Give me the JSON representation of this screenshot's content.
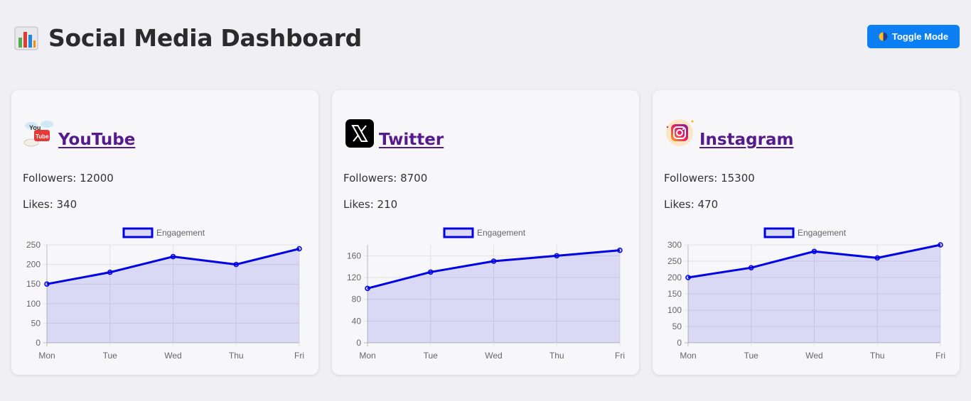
{
  "header": {
    "title": "Social Media Dashboard",
    "title_icon": "bar-chart-icon",
    "toggle_label": "Toggle Mode",
    "toggle_icon": "half-circle-icon"
  },
  "colors": {
    "accent": "#0d7ff5",
    "line": "#0000e6",
    "fill": "rgba(0,0,230,0.12)",
    "link": "#551a8b"
  },
  "cards": [
    {
      "platform": "YouTube",
      "logo_icon": "youtube-logo-icon",
      "followers_text": "Followers: 12000",
      "likes_text": "Likes: 340"
    },
    {
      "platform": "Twitter",
      "logo_icon": "x-logo-icon",
      "followers_text": "Followers: 8700",
      "likes_text": "Likes: 210"
    },
    {
      "platform": "Instagram",
      "logo_icon": "instagram-logo-icon",
      "followers_text": "Followers: 15300",
      "likes_text": "Likes: 470"
    }
  ],
  "chart_data": [
    {
      "type": "area",
      "categories": [
        "Mon",
        "Tue",
        "Wed",
        "Thu",
        "Fri"
      ],
      "series": [
        {
          "name": "Engagement",
          "values": [
            150,
            180,
            220,
            200,
            240
          ]
        }
      ],
      "ylim": [
        0,
        250
      ],
      "yticks": [
        0,
        50,
        100,
        150,
        200,
        250
      ],
      "grid": true,
      "legend": "top-center"
    },
    {
      "type": "area",
      "categories": [
        "Mon",
        "Tue",
        "Wed",
        "Thu",
        "Fri"
      ],
      "series": [
        {
          "name": "Engagement",
          "values": [
            100,
            130,
            150,
            160,
            170
          ]
        }
      ],
      "ylim": [
        0,
        180
      ],
      "yticks": [
        0,
        40,
        80,
        120,
        160
      ],
      "grid": true,
      "legend": "top-center"
    },
    {
      "type": "area",
      "categories": [
        "Mon",
        "Tue",
        "Wed",
        "Thu",
        "Fri"
      ],
      "series": [
        {
          "name": "Engagement",
          "values": [
            200,
            230,
            280,
            260,
            300
          ]
        }
      ],
      "ylim": [
        0,
        300
      ],
      "yticks": [
        0,
        50,
        100,
        150,
        200,
        250,
        300
      ],
      "grid": true,
      "legend": "top-center"
    }
  ]
}
